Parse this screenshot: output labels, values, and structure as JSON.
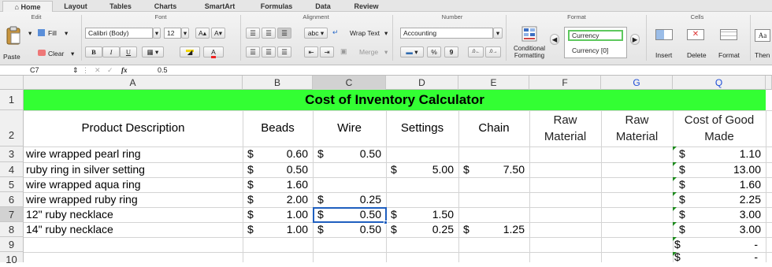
{
  "ribbon_tabs": [
    "Home",
    "Layout",
    "Tables",
    "Charts",
    "SmartArt",
    "Formulas",
    "Data",
    "Review"
  ],
  "groups": {
    "edit": "Edit",
    "font": "Font",
    "alignment": "Alignment",
    "number": "Number",
    "format": "Format",
    "cells": "Cells"
  },
  "edit": {
    "paste": "Paste",
    "fill": "Fill",
    "clear": "Clear"
  },
  "font": {
    "name": "Calibri (Body)",
    "size": "12",
    "bold": "B",
    "italic": "I",
    "underline": "U",
    "grow": "A▴",
    "shrink": "A▾",
    "font_color_glyph": "A"
  },
  "alignment": {
    "abc": "abc",
    "wrap_text": "Wrap Text",
    "merge": "Merge"
  },
  "number": {
    "format": "Accounting",
    "percent": "%",
    "comma": "9"
  },
  "format": {
    "conditional": "Conditional\nFormatting",
    "style1": "Currency",
    "style2": "Currency [0]"
  },
  "cells": {
    "insert": "Insert",
    "delete": "Delete",
    "format": "Format",
    "themes": "Then",
    "themes_glyph": "Aa"
  },
  "formula_bar": {
    "cell_ref": "C7",
    "fx": "fx",
    "value": "0.5"
  },
  "columns": [
    "A",
    "B",
    "C",
    "D",
    "E",
    "F",
    "G",
    "Q"
  ],
  "rows": [
    "1",
    "2",
    "3",
    "4",
    "5",
    "6",
    "7",
    "8",
    "9",
    "10"
  ],
  "sheet": {
    "title": "Cost of Inventory Calculator",
    "headers": {
      "product": "Product Description",
      "beads": "Beads",
      "wire": "Wire",
      "settings": "Settings",
      "chain": "Chain",
      "raw1_a": "Raw",
      "raw1_b": "Material",
      "raw2_a": "Raw",
      "raw2_b": "Material",
      "cost_a": "Cost of Good",
      "cost_b": "Made"
    },
    "currency_symbol": "$",
    "dash": "-",
    "rows": [
      {
        "desc": "wire wrapped pearl ring",
        "beads": "0.60",
        "wire": "0.50",
        "settings": "",
        "chain": "",
        "cost": "1.10"
      },
      {
        "desc": "ruby ring in silver setting",
        "beads": "0.50",
        "wire": "",
        "settings": "5.00",
        "chain": "7.50",
        "cost": "13.00"
      },
      {
        "desc": "wire wrapped aqua ring",
        "beads": "1.60",
        "wire": "",
        "settings": "",
        "chain": "",
        "cost": "1.60"
      },
      {
        "desc": "wire wrapped ruby ring",
        "beads": "2.00",
        "wire": "0.25",
        "settings": "",
        "chain": "",
        "cost": "2.25"
      },
      {
        "desc": "12\" ruby necklace",
        "beads": "1.00",
        "wire": "0.50",
        "settings": "1.50",
        "chain": "",
        "cost": "3.00"
      },
      {
        "desc": "14\" ruby necklace",
        "beads": "1.00",
        "wire": "0.50",
        "settings": "0.25",
        "chain": "1.25",
        "cost": "3.00"
      }
    ]
  },
  "colors": {
    "title_fill": "#33ff33",
    "selection": "#1f5fbf",
    "error_triangle": "#1e8a1e"
  }
}
